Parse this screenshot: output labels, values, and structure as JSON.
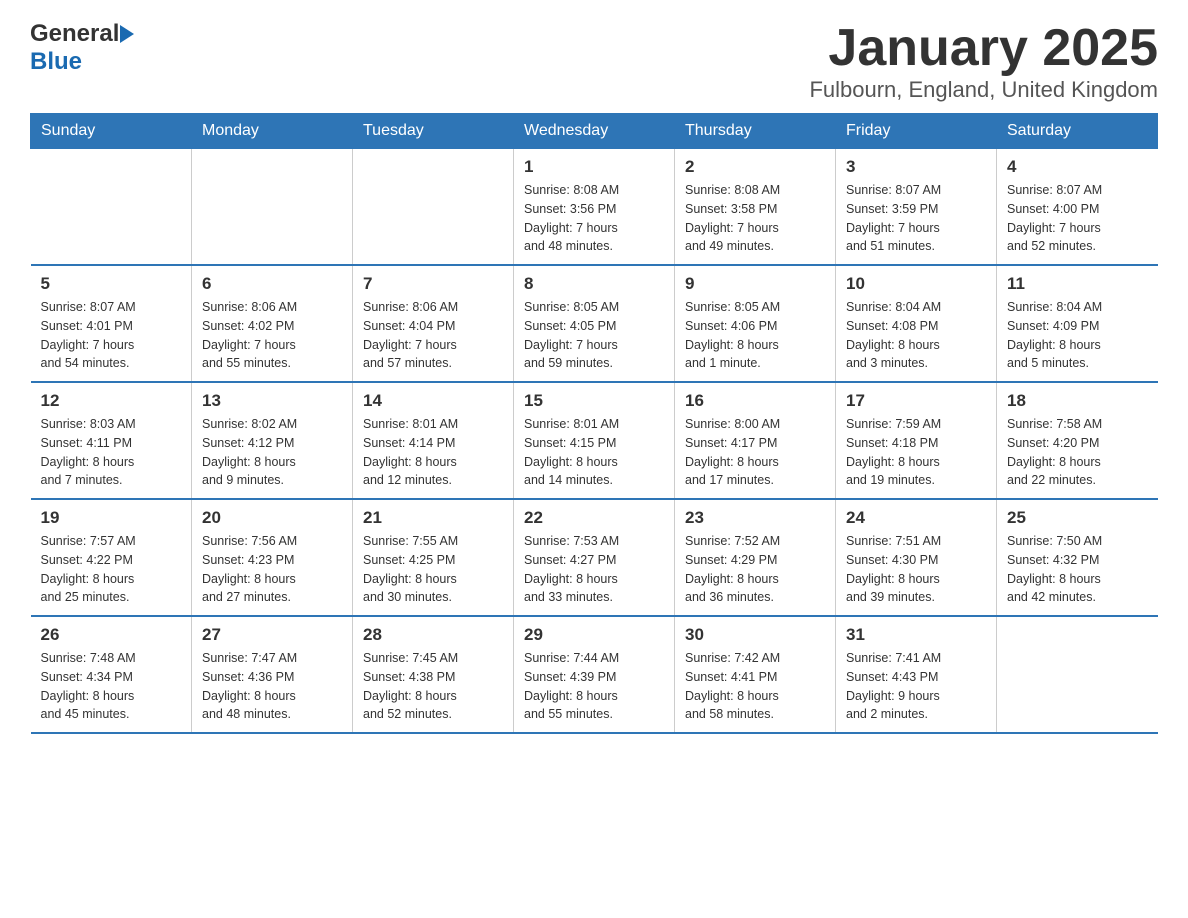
{
  "header": {
    "title": "January 2025",
    "subtitle": "Fulbourn, England, United Kingdom"
  },
  "logo": {
    "part1": "General",
    "part2": "Blue"
  },
  "days_of_week": [
    "Sunday",
    "Monday",
    "Tuesday",
    "Wednesday",
    "Thursday",
    "Friday",
    "Saturday"
  ],
  "weeks": [
    [
      {
        "day": "",
        "info": ""
      },
      {
        "day": "",
        "info": ""
      },
      {
        "day": "",
        "info": ""
      },
      {
        "day": "1",
        "info": "Sunrise: 8:08 AM\nSunset: 3:56 PM\nDaylight: 7 hours\nand 48 minutes."
      },
      {
        "day": "2",
        "info": "Sunrise: 8:08 AM\nSunset: 3:58 PM\nDaylight: 7 hours\nand 49 minutes."
      },
      {
        "day": "3",
        "info": "Sunrise: 8:07 AM\nSunset: 3:59 PM\nDaylight: 7 hours\nand 51 minutes."
      },
      {
        "day": "4",
        "info": "Sunrise: 8:07 AM\nSunset: 4:00 PM\nDaylight: 7 hours\nand 52 minutes."
      }
    ],
    [
      {
        "day": "5",
        "info": "Sunrise: 8:07 AM\nSunset: 4:01 PM\nDaylight: 7 hours\nand 54 minutes."
      },
      {
        "day": "6",
        "info": "Sunrise: 8:06 AM\nSunset: 4:02 PM\nDaylight: 7 hours\nand 55 minutes."
      },
      {
        "day": "7",
        "info": "Sunrise: 8:06 AM\nSunset: 4:04 PM\nDaylight: 7 hours\nand 57 minutes."
      },
      {
        "day": "8",
        "info": "Sunrise: 8:05 AM\nSunset: 4:05 PM\nDaylight: 7 hours\nand 59 minutes."
      },
      {
        "day": "9",
        "info": "Sunrise: 8:05 AM\nSunset: 4:06 PM\nDaylight: 8 hours\nand 1 minute."
      },
      {
        "day": "10",
        "info": "Sunrise: 8:04 AM\nSunset: 4:08 PM\nDaylight: 8 hours\nand 3 minutes."
      },
      {
        "day": "11",
        "info": "Sunrise: 8:04 AM\nSunset: 4:09 PM\nDaylight: 8 hours\nand 5 minutes."
      }
    ],
    [
      {
        "day": "12",
        "info": "Sunrise: 8:03 AM\nSunset: 4:11 PM\nDaylight: 8 hours\nand 7 minutes."
      },
      {
        "day": "13",
        "info": "Sunrise: 8:02 AM\nSunset: 4:12 PM\nDaylight: 8 hours\nand 9 minutes."
      },
      {
        "day": "14",
        "info": "Sunrise: 8:01 AM\nSunset: 4:14 PM\nDaylight: 8 hours\nand 12 minutes."
      },
      {
        "day": "15",
        "info": "Sunrise: 8:01 AM\nSunset: 4:15 PM\nDaylight: 8 hours\nand 14 minutes."
      },
      {
        "day": "16",
        "info": "Sunrise: 8:00 AM\nSunset: 4:17 PM\nDaylight: 8 hours\nand 17 minutes."
      },
      {
        "day": "17",
        "info": "Sunrise: 7:59 AM\nSunset: 4:18 PM\nDaylight: 8 hours\nand 19 minutes."
      },
      {
        "day": "18",
        "info": "Sunrise: 7:58 AM\nSunset: 4:20 PM\nDaylight: 8 hours\nand 22 minutes."
      }
    ],
    [
      {
        "day": "19",
        "info": "Sunrise: 7:57 AM\nSunset: 4:22 PM\nDaylight: 8 hours\nand 25 minutes."
      },
      {
        "day": "20",
        "info": "Sunrise: 7:56 AM\nSunset: 4:23 PM\nDaylight: 8 hours\nand 27 minutes."
      },
      {
        "day": "21",
        "info": "Sunrise: 7:55 AM\nSunset: 4:25 PM\nDaylight: 8 hours\nand 30 minutes."
      },
      {
        "day": "22",
        "info": "Sunrise: 7:53 AM\nSunset: 4:27 PM\nDaylight: 8 hours\nand 33 minutes."
      },
      {
        "day": "23",
        "info": "Sunrise: 7:52 AM\nSunset: 4:29 PM\nDaylight: 8 hours\nand 36 minutes."
      },
      {
        "day": "24",
        "info": "Sunrise: 7:51 AM\nSunset: 4:30 PM\nDaylight: 8 hours\nand 39 minutes."
      },
      {
        "day": "25",
        "info": "Sunrise: 7:50 AM\nSunset: 4:32 PM\nDaylight: 8 hours\nand 42 minutes."
      }
    ],
    [
      {
        "day": "26",
        "info": "Sunrise: 7:48 AM\nSunset: 4:34 PM\nDaylight: 8 hours\nand 45 minutes."
      },
      {
        "day": "27",
        "info": "Sunrise: 7:47 AM\nSunset: 4:36 PM\nDaylight: 8 hours\nand 48 minutes."
      },
      {
        "day": "28",
        "info": "Sunrise: 7:45 AM\nSunset: 4:38 PM\nDaylight: 8 hours\nand 52 minutes."
      },
      {
        "day": "29",
        "info": "Sunrise: 7:44 AM\nSunset: 4:39 PM\nDaylight: 8 hours\nand 55 minutes."
      },
      {
        "day": "30",
        "info": "Sunrise: 7:42 AM\nSunset: 4:41 PM\nDaylight: 8 hours\nand 58 minutes."
      },
      {
        "day": "31",
        "info": "Sunrise: 7:41 AM\nSunset: 4:43 PM\nDaylight: 9 hours\nand 2 minutes."
      },
      {
        "day": "",
        "info": ""
      }
    ]
  ]
}
